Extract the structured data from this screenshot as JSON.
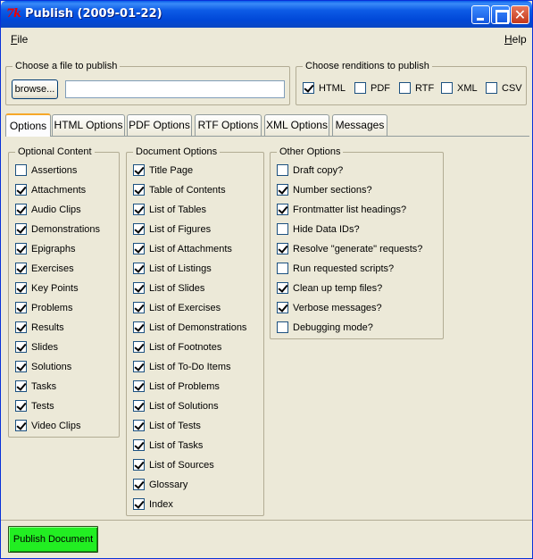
{
  "window": {
    "title": "Publish (2009-01-22)",
    "icon": "tk-feather-icon",
    "close_glyph": "✕"
  },
  "menubar": {
    "file": "File",
    "help": "Help"
  },
  "file_group": {
    "legend": "Choose a file to publish",
    "browse_label": "browse...",
    "file_value": ""
  },
  "renditions_group": {
    "legend": "Choose renditions to publish",
    "items": [
      {
        "label": "HTML",
        "checked": true
      },
      {
        "label": "PDF",
        "checked": false
      },
      {
        "label": "RTF",
        "checked": false
      },
      {
        "label": "XML",
        "checked": false
      },
      {
        "label": "CSV",
        "checked": false
      }
    ]
  },
  "tabs": [
    {
      "label": "Options",
      "active": true
    },
    {
      "label": "HTML Options",
      "active": false
    },
    {
      "label": "PDF Options",
      "active": false
    },
    {
      "label": "RTF Options",
      "active": false
    },
    {
      "label": "XML Options",
      "active": false
    },
    {
      "label": "Messages",
      "active": false
    }
  ],
  "optional_content": {
    "legend": "Optional Content",
    "items": [
      {
        "label": "Assertions",
        "checked": false
      },
      {
        "label": "Attachments",
        "checked": true
      },
      {
        "label": "Audio Clips",
        "checked": true
      },
      {
        "label": "Demonstrations",
        "checked": true
      },
      {
        "label": "Epigraphs",
        "checked": true
      },
      {
        "label": "Exercises",
        "checked": true
      },
      {
        "label": "Key Points",
        "checked": true
      },
      {
        "label": "Problems",
        "checked": true
      },
      {
        "label": "Results",
        "checked": true
      },
      {
        "label": "Slides",
        "checked": true
      },
      {
        "label": "Solutions",
        "checked": true
      },
      {
        "label": "Tasks",
        "checked": true
      },
      {
        "label": "Tests",
        "checked": true
      },
      {
        "label": "Video Clips",
        "checked": true
      }
    ]
  },
  "document_options": {
    "legend": "Document Options",
    "items": [
      {
        "label": "Title Page",
        "checked": true
      },
      {
        "label": "Table of Contents",
        "checked": true
      },
      {
        "label": "List of Tables",
        "checked": true
      },
      {
        "label": "List of Figures",
        "checked": true
      },
      {
        "label": "List of Attachments",
        "checked": true
      },
      {
        "label": "List of Listings",
        "checked": true
      },
      {
        "label": "List of Slides",
        "checked": true
      },
      {
        "label": "List of Exercises",
        "checked": true
      },
      {
        "label": "List of Demonstrations",
        "checked": true
      },
      {
        "label": "List of Footnotes",
        "checked": true
      },
      {
        "label": "List of To-Do Items",
        "checked": true
      },
      {
        "label": "List of Problems",
        "checked": true
      },
      {
        "label": "List of Solutions",
        "checked": true
      },
      {
        "label": "List of Tests",
        "checked": true
      },
      {
        "label": "List of Tasks",
        "checked": true
      },
      {
        "label": "List of Sources",
        "checked": true
      },
      {
        "label": "Glossary",
        "checked": true
      },
      {
        "label": "Index",
        "checked": true
      }
    ]
  },
  "other_options": {
    "legend": "Other Options",
    "items": [
      {
        "label": "Draft copy?",
        "checked": false
      },
      {
        "label": "Number sections?",
        "checked": true
      },
      {
        "label": "Frontmatter list headings?",
        "checked": true
      },
      {
        "label": "Hide Data IDs?",
        "checked": false
      },
      {
        "label": "Resolve \"generate\" requests?",
        "checked": true
      },
      {
        "label": "Run requested scripts?",
        "checked": false
      },
      {
        "label": "Clean up temp files?",
        "checked": true
      },
      {
        "label": "Verbose messages?",
        "checked": true
      },
      {
        "label": "Debugging mode?",
        "checked": false
      }
    ]
  },
  "actions": {
    "publish_label": "Publish Document",
    "publish_color": "#22ee22"
  }
}
